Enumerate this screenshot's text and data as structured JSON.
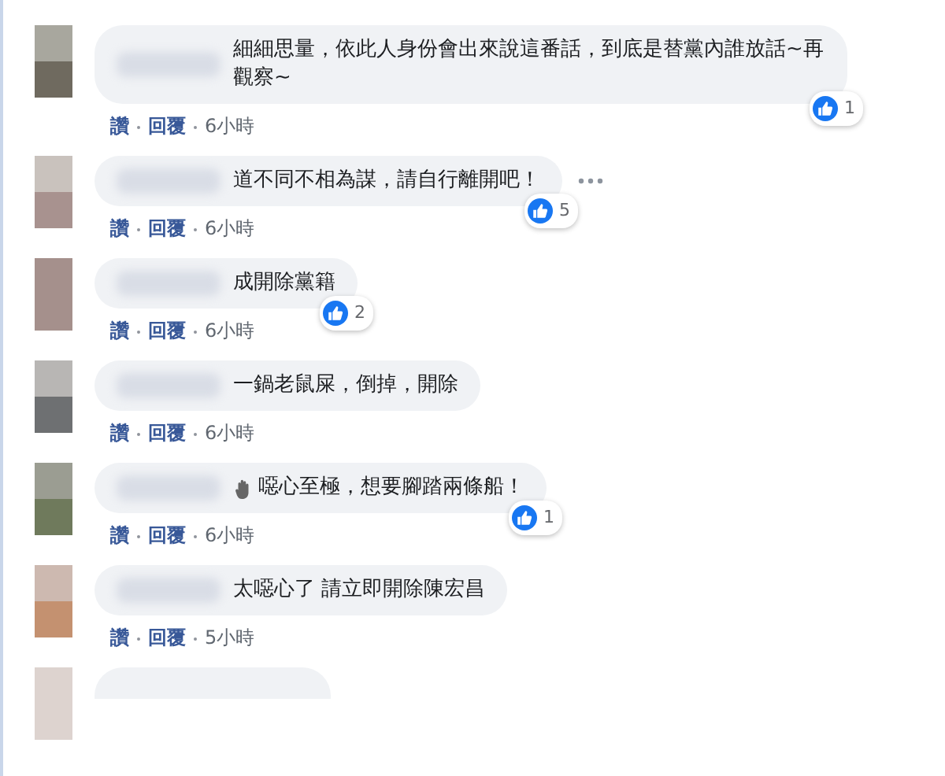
{
  "comments": [
    {
      "kind": "full",
      "text": "細細思量，依此人身份會出來說這番話，到底是替黨內誰放話~再觀察~",
      "emoji": false,
      "more": false,
      "reactions": "1",
      "actions": [
        "讚",
        "回覆"
      ],
      "time": "6小時"
    },
    {
      "kind": "full",
      "text": "道不同不相為謀，請自行離開吧！",
      "emoji": false,
      "more": true,
      "reactions": "5",
      "actions": [
        "讚",
        "回覆"
      ],
      "time": "6小時"
    },
    {
      "kind": "full",
      "text": "成開除黨籍",
      "emoji": false,
      "more": false,
      "reactions": "2",
      "actions": [
        "讚",
        "回覆"
      ],
      "time": "6小時"
    },
    {
      "kind": "full",
      "text": "一鍋老鼠屎，倒掉，開除",
      "emoji": false,
      "more": false,
      "actions": [
        "讚",
        "回覆"
      ],
      "time": "6小時"
    },
    {
      "kind": "full",
      "text": "噁心至極，想要腳踏兩條船！",
      "emoji": true,
      "more": false,
      "reactions": "1",
      "actions": [
        "讚",
        "回覆"
      ],
      "time": "6小時"
    },
    {
      "kind": "full",
      "text": "太噁心了 請立即開除陳宏昌",
      "emoji": false,
      "more": false,
      "actions": [
        "讚",
        "回覆"
      ],
      "time": "5小時"
    },
    {
      "kind": "partial"
    }
  ]
}
